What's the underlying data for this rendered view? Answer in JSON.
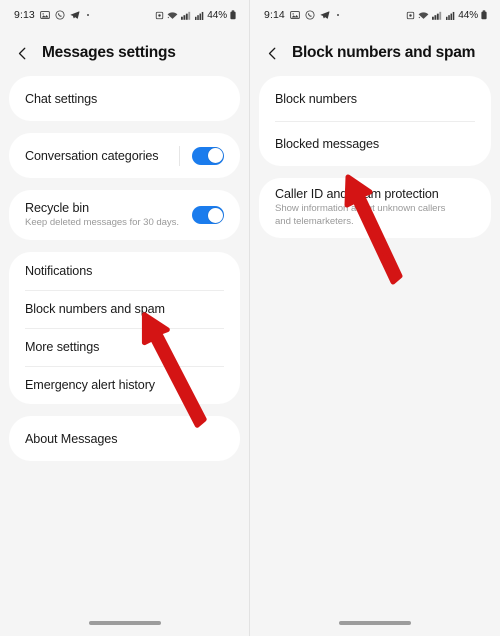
{
  "theme": {
    "page_background": "#f5f5f5",
    "card_background": "#ffffff",
    "accent_toggle_on": "#1b7ced",
    "annotation_arrow": "#d41414",
    "title_color": "#111111",
    "label_color": "#1a1a1a",
    "sub_label_color": "#9a9a9a"
  },
  "screens": [
    {
      "id": "messages-settings",
      "statusbar": {
        "time": "9:13",
        "icons": [
          "gallery-icon",
          "whatsapp-icon",
          "telegram-icon",
          "dot-icon"
        ],
        "right_icons": [
          "alarm-icon",
          "wifi-icon",
          "signal-icon",
          "signal-bars-icon"
        ],
        "battery": "44%",
        "battery_icon": "battery-icon"
      },
      "header": {
        "back_icon": "chevron-left-icon",
        "title": "Messages settings"
      },
      "groups": [
        {
          "rows": [
            {
              "label": "Chat settings",
              "sub": "",
              "control": "none"
            }
          ]
        },
        {
          "rows": [
            {
              "label": "Conversation categories",
              "sub": "",
              "control": "toggle",
              "toggle_on": true
            }
          ]
        },
        {
          "rows": [
            {
              "label": "Recycle bin",
              "sub": "Keep deleted messages for 30 days.",
              "control": "toggle",
              "toggle_on": true
            }
          ]
        },
        {
          "rows": [
            {
              "label": "Notifications",
              "sub": "",
              "control": "none"
            },
            {
              "label": "Block numbers and spam",
              "sub": "",
              "control": "none"
            },
            {
              "label": "More settings",
              "sub": "",
              "control": "none"
            },
            {
              "label": "Emergency alert history",
              "sub": "",
              "control": "none"
            }
          ]
        },
        {
          "rows": [
            {
              "label": "About Messages",
              "sub": "",
              "control": "none"
            }
          ]
        }
      ],
      "annotation": {
        "name": "red-arrow-annotation",
        "points_to": "Block numbers and spam"
      },
      "navbar": {
        "pill": "home-gesture-pill"
      }
    },
    {
      "id": "block-numbers-and-spam",
      "statusbar": {
        "time": "9:14",
        "icons": [
          "gallery-icon",
          "whatsapp-icon",
          "telegram-icon",
          "dot-icon"
        ],
        "right_icons": [
          "alarm-icon",
          "wifi-icon",
          "signal-icon",
          "signal-bars-icon"
        ],
        "battery": "44%",
        "battery_icon": "battery-icon"
      },
      "header": {
        "back_icon": "chevron-left-icon",
        "title": "Block numbers and spam"
      },
      "groups": [
        {
          "rows": [
            {
              "label": "Block numbers",
              "sub": "",
              "control": "none"
            },
            {
              "label": "Blocked messages",
              "sub": "",
              "control": "none"
            }
          ]
        },
        {
          "rows": [
            {
              "label": "Caller ID and spam protection",
              "sub": "Show information about unknown callers and telemarketers.",
              "control": "none"
            }
          ]
        }
      ],
      "annotation": {
        "name": "red-arrow-annotation",
        "points_to": "Blocked messages"
      },
      "navbar": {
        "pill": "home-gesture-pill"
      }
    }
  ]
}
